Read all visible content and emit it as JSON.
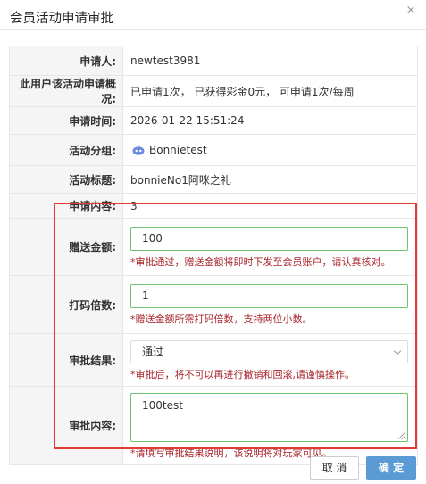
{
  "dialog": {
    "title": "会员活动申请审批",
    "close_icon": "×"
  },
  "rows": {
    "applicant": {
      "label": "申请人:",
      "value": "newtest3981"
    },
    "summary": {
      "label": "此用户该活动申请概况:",
      "value": "已申请1次，  已获得彩金0元，  可申请1次/每周"
    },
    "time": {
      "label": "申请时间:",
      "value": "2026-01-22 15:51:24"
    },
    "group": {
      "label": "活动分组:",
      "value": "Bonnietest",
      "icon": "bot-avatar-icon"
    },
    "activity_title": {
      "label": "活动标题:",
      "value": "bonnieNo1阿咪之礼"
    },
    "content": {
      "label": "申请内容:",
      "value": "3"
    }
  },
  "form": {
    "bonus": {
      "label": "赠送金额:",
      "value": "100",
      "note": "*审批通过，赠送金额将即时下发至会员账户，请认真核对。"
    },
    "multiplier": {
      "label": "打码倍数:",
      "value": "1",
      "note": "*赠送金额所需打码倍数，支持两位小数。"
    },
    "result": {
      "label": "审批结果:",
      "selected": "通过",
      "note": "*审批后，将不可以再进行撤销和回滚,请谨慎操作。"
    },
    "remark": {
      "label": "审批内容:",
      "value": "100test",
      "note": "*请填写审批结果说明，该说明将对玩家可见。"
    }
  },
  "buttons": {
    "cancel": "取 消",
    "confirm": "确 定"
  },
  "colors": {
    "highlight_border": "#e53935",
    "note_red": "#a8252c",
    "input_green": "#6cc26f",
    "primary": "#5b9bd5"
  }
}
